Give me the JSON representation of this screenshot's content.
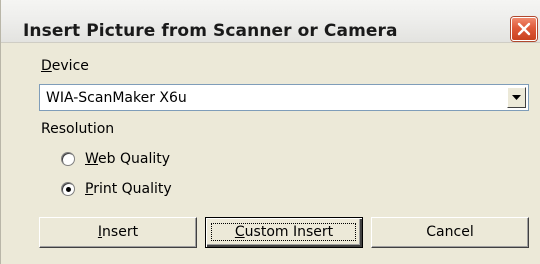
{
  "window": {
    "title": "Insert Picture from Scanner or Camera"
  },
  "device": {
    "label_key": "D",
    "label_rest": "evice",
    "selected": "WIA-ScanMaker X6u"
  },
  "resolution": {
    "label": "Resolution",
    "options": [
      {
        "key": "W",
        "rest": "eb Quality",
        "selected": false
      },
      {
        "key": "P",
        "rest": "rint Quality",
        "selected": true
      }
    ]
  },
  "buttons": {
    "insert_key": "I",
    "insert_rest": "nsert",
    "custom_key": "C",
    "custom_rest": "ustom Insert",
    "cancel": "Cancel"
  },
  "colors": {
    "dialog_bg": "#ece9d8",
    "close_red": "#df5a3a"
  }
}
